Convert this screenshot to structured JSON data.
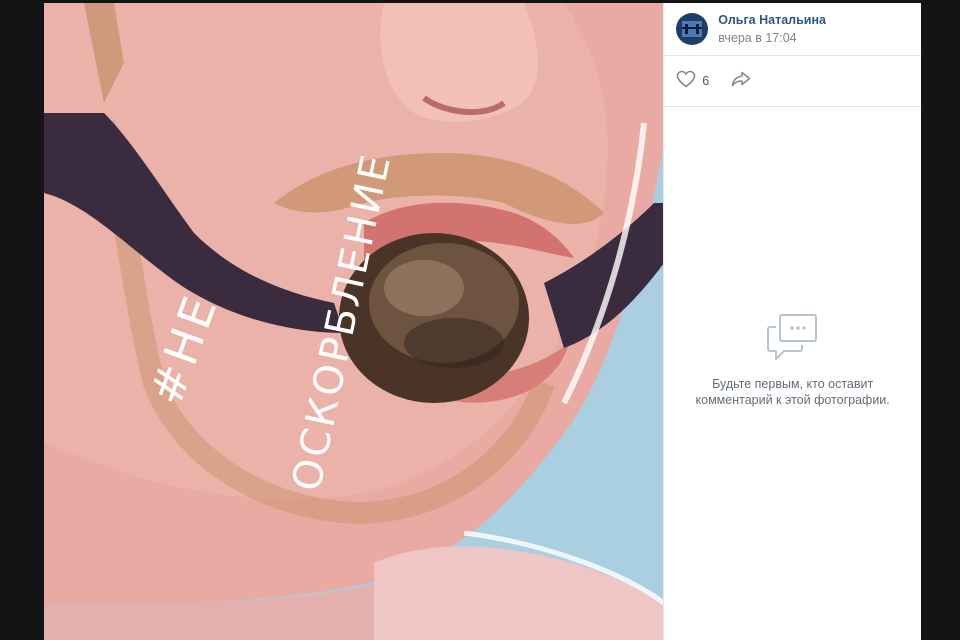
{
  "post": {
    "author_name": "Ольга Натальина",
    "time": "вчера в 17:04",
    "likes": "6"
  },
  "comments": {
    "empty_line1": "Будьте первым, кто оставит",
    "empty_line2": "комментарий к этой фотографии."
  },
  "photo": {
    "caption_line1": "#НЕ",
    "caption_line2": "ОСКОРБЛЕНИЕ"
  },
  "icons": {
    "like": "heart-icon",
    "share": "share-arrow-icon",
    "comments_empty": "speech-bubbles-icon"
  },
  "colors": {
    "link": "#2a5885",
    "muted": "#828282",
    "sky": "#a9cfe1",
    "skin": "#e8a7a0"
  }
}
